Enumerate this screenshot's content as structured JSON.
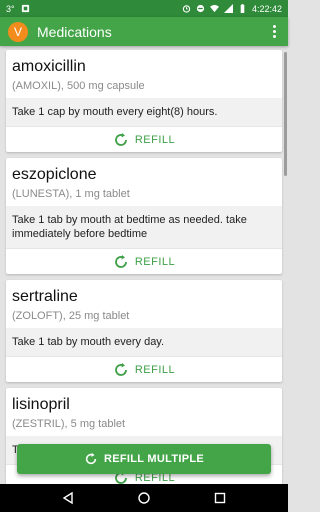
{
  "status_bar": {
    "left_text": "3°",
    "time": "4:22:42"
  },
  "app_bar": {
    "avatar_letter": "V",
    "title": "Medications"
  },
  "medications": [
    {
      "name": "amoxicillin",
      "detail": "(AMOXIL), 500 mg capsule",
      "instructions": "Take 1 cap by mouth every eight(8) hours.",
      "refill_label": "REFILL"
    },
    {
      "name": "eszopiclone",
      "detail": "(LUNESTA), 1 mg tablet",
      "instructions": "Take 1 tab by mouth at bedtime as needed. take immediately before bedtime",
      "refill_label": "REFILL"
    },
    {
      "name": "sertraline",
      "detail": "(ZOLOFT), 25 mg tablet",
      "instructions": "Take 1 tab by mouth every day.",
      "refill_label": "REFILL"
    },
    {
      "name": "lisinopril",
      "detail": "(ZESTRIL), 5 mg tablet",
      "instructions": "Take 1 tab by mouth every day.",
      "refill_label": "REFILL"
    }
  ],
  "fab": {
    "label": "REFILL MULTIPLE"
  },
  "colors": {
    "status_bar": "#2f8b3a",
    "app_bar": "#43a548",
    "accent": "#3fa047",
    "avatar": "#f28c1c"
  },
  "icons": {
    "refill": "refresh-icon",
    "menu": "more-vert-icon",
    "nav": [
      "back-icon",
      "home-icon",
      "recents-icon"
    ]
  }
}
